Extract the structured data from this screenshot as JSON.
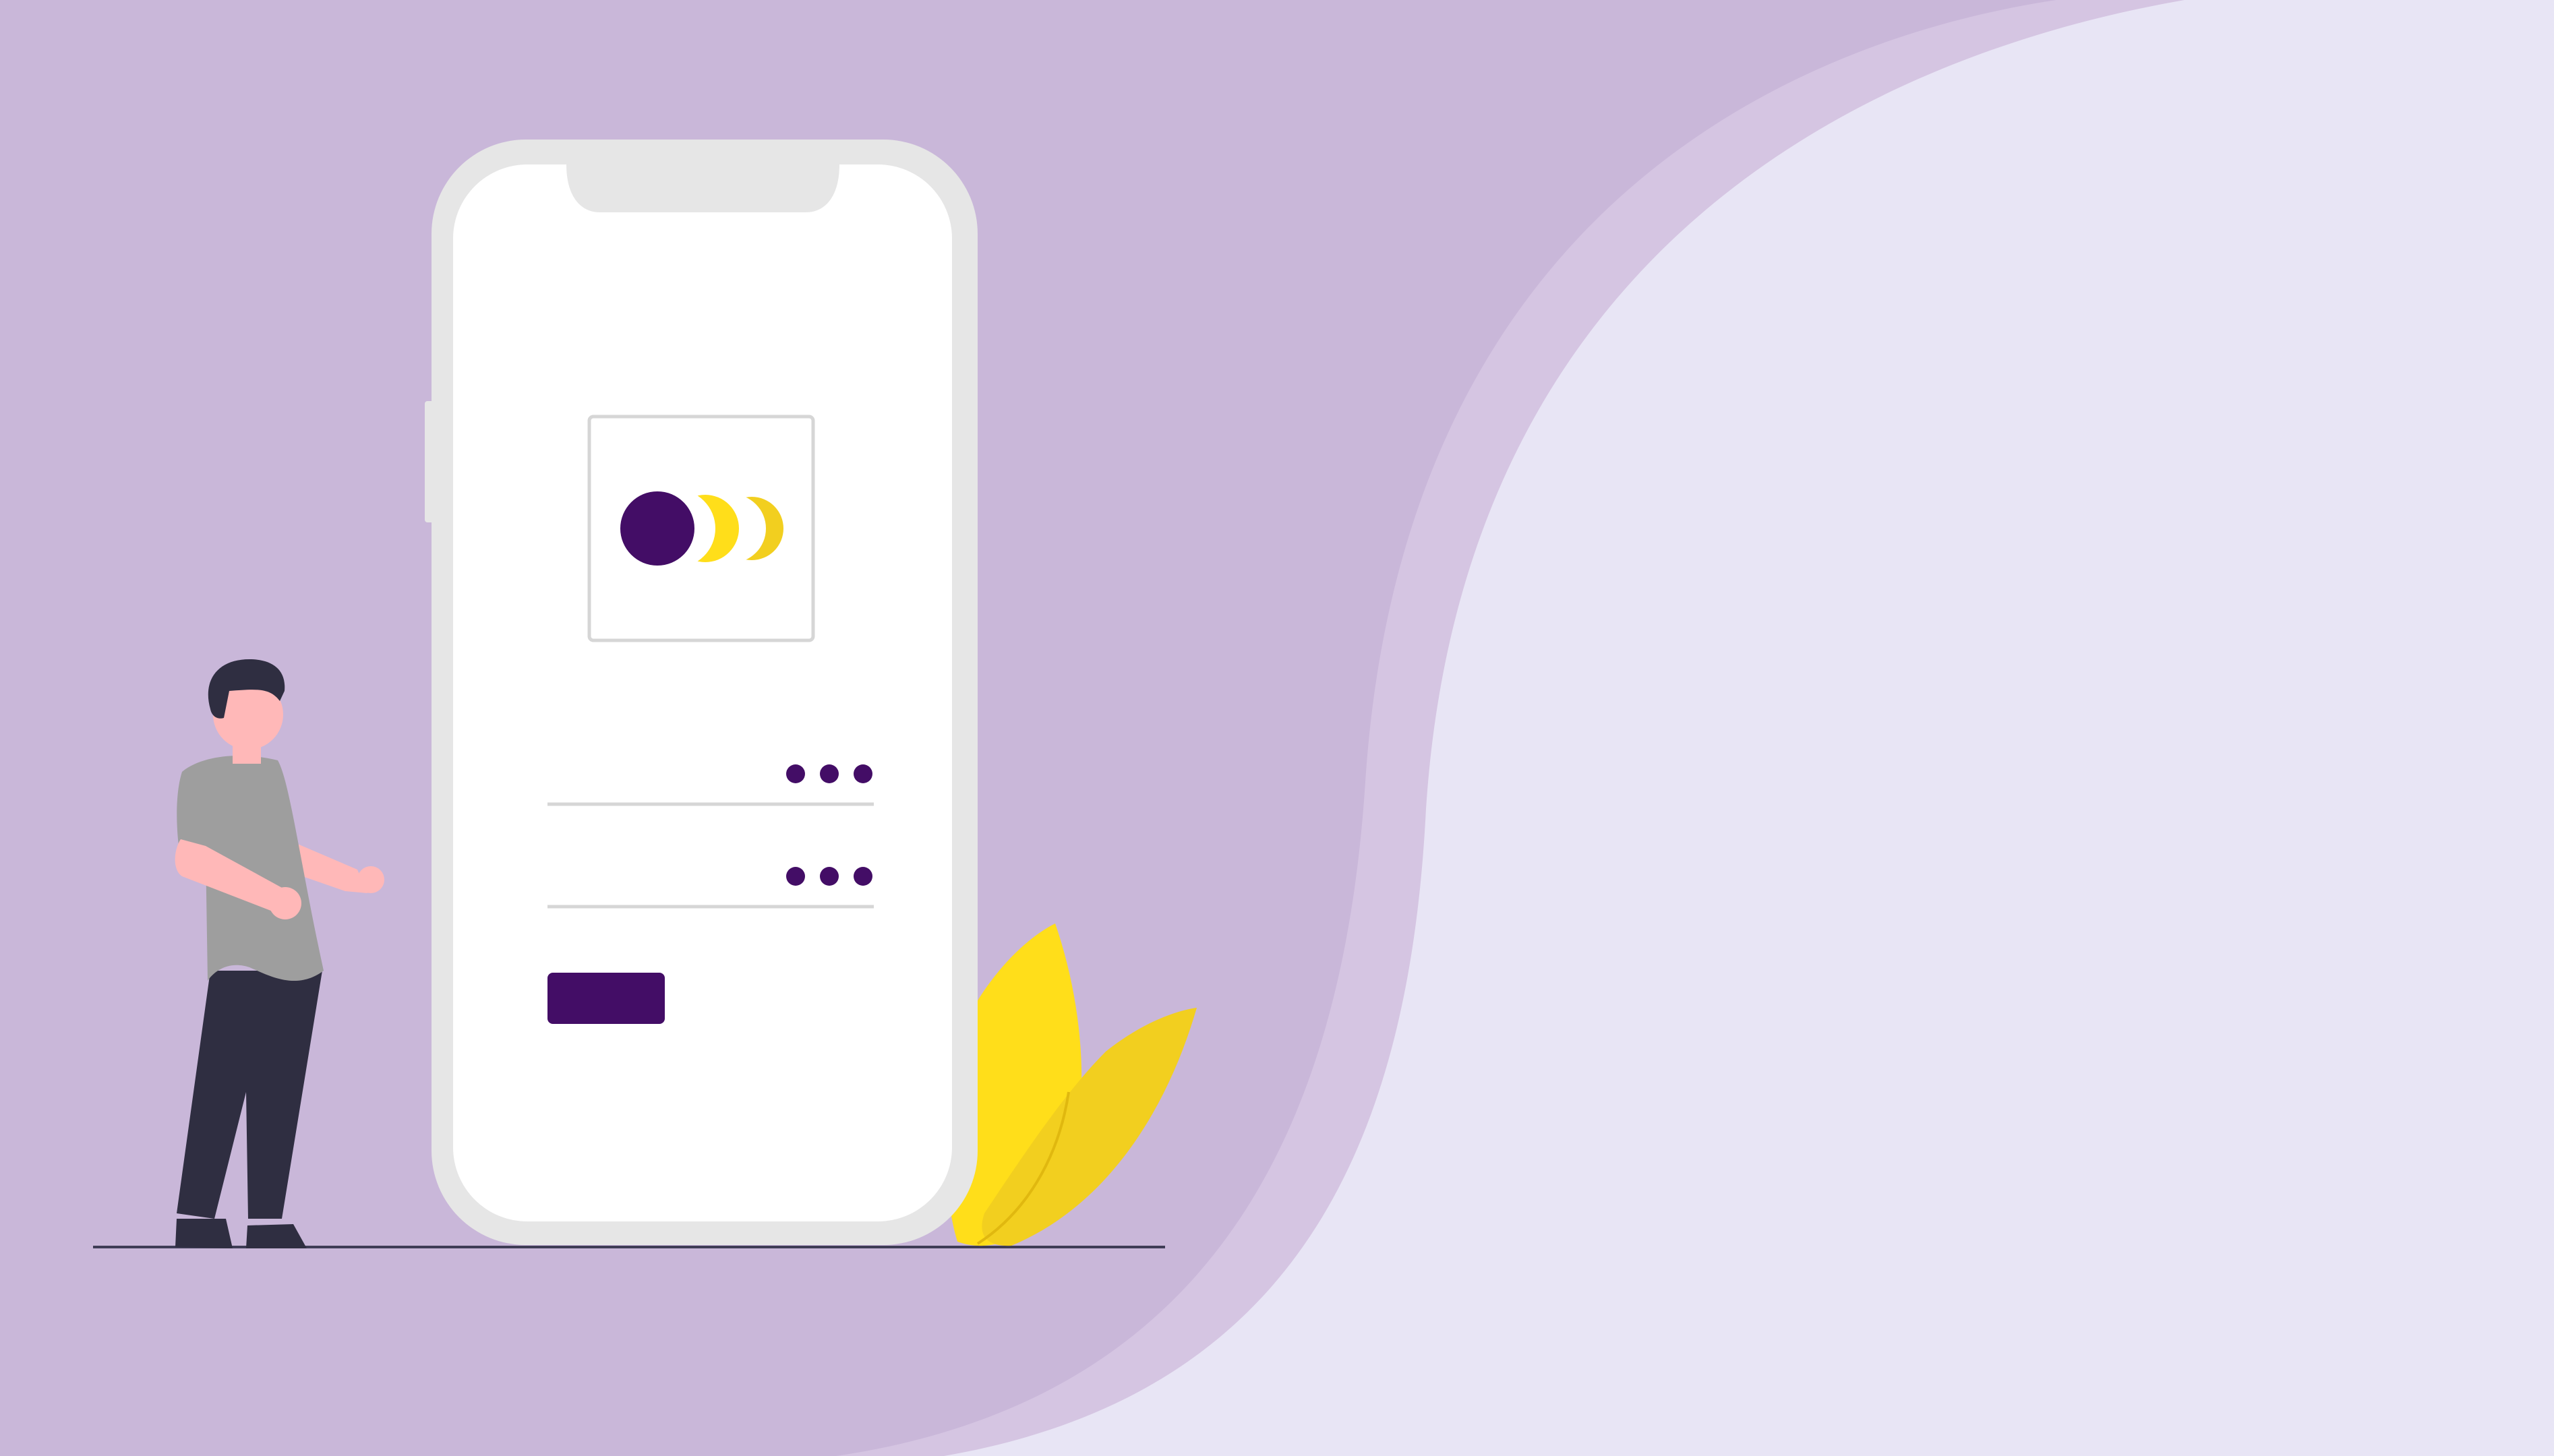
{
  "colors": {
    "background": "#c9b7d9",
    "wave_outer": "#d5c5e2",
    "wave_inner": "#e8e5f5",
    "phone_frame": "#e6e6e6",
    "phone_screen": "#ffffff",
    "accent": "#430d66",
    "yellow": "#ffde1a",
    "yellow_dark": "#f2cf1f",
    "pants": "#2f2e41",
    "shirt": "#9e9e9e",
    "skin": "#ffb8b8",
    "hair": "#2f2e41",
    "ground_line": "#3f3d56"
  },
  "login_form": {
    "logo": "three-circles-logo",
    "username_mask": "•••",
    "password_mask": "•••",
    "submit_label": ""
  },
  "icons": {
    "logo": "three-circles-logo",
    "plant": "yellow-leaves-plant",
    "person": "standing-person-illustration"
  }
}
